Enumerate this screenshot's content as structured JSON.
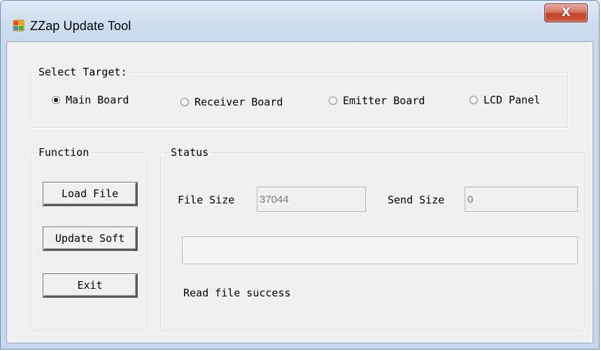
{
  "window": {
    "title": "ZZap Update Tool",
    "close_glyph": "X",
    "icon": "app-icon"
  },
  "select_target": {
    "label": "Select Target:",
    "options": [
      {
        "label": "Main Board",
        "checked": true
      },
      {
        "label": "Receiver Board",
        "checked": false
      },
      {
        "label": "Emitter Board",
        "checked": false
      },
      {
        "label": "LCD Panel",
        "checked": false
      }
    ]
  },
  "function": {
    "label": "Function",
    "buttons": {
      "load": "Load File",
      "update": "Update Soft",
      "exit": "Exit"
    }
  },
  "status": {
    "label": "Status",
    "file_size_label": "File Size",
    "file_size_value": "37044",
    "send_size_label": "Send Size",
    "send_size_value": "0",
    "progress": 0,
    "message": "Read file success"
  },
  "colors": {
    "client_bg": "#f0f0f0",
    "close_button": "#c4442b",
    "frame": "#cfdef0"
  }
}
